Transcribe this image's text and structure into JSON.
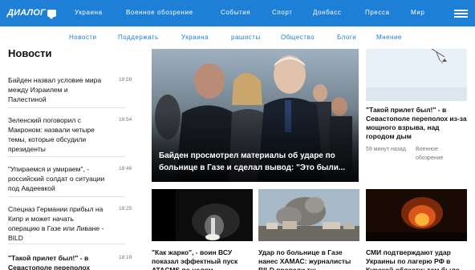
{
  "header": {
    "logo": "ДИАЛОГ",
    "nav": [
      "Украина",
      "Военное обозрение",
      "События",
      "Спорт",
      "Донбасс",
      "Пресса",
      "Мир"
    ]
  },
  "subnav": [
    "Новости",
    "Поддержать",
    "Украина",
    "рашисты",
    "Общество",
    "Блоги",
    "Мнение"
  ],
  "news": {
    "title": "Новости",
    "items": [
      {
        "text": "Байден назвал условие мира между Израилем и Палестиной",
        "time": "18:59"
      },
      {
        "text": "Зеленский поговорил с Макроном: назвали четыре темы, которые обсудили президенты",
        "time": "18:54"
      },
      {
        "text": "\"Упираемся и умираем\", - российский солдат о ситуации под Авдеевкой",
        "time": "18:46"
      },
      {
        "text": "Спецназ Германии прибыл на Кипр и может начать операцию в Газе или Ливане - BILD",
        "time": "18:25"
      },
      {
        "text": "\"Такой прилет был!\" - в Севастополе переполох",
        "time": "18:19"
      }
    ]
  },
  "feature": {
    "title": "Байден просмотрел материалы об ударе по больнице в Газе и сделал вывод: \"Это были..."
  },
  "side_card": {
    "title": "\"Такой прилет был!\" - в Севастополе переполох из-за мощного взрыва, над городом дым",
    "time": "59 минут назад",
    "category": "Военное обозрение"
  },
  "bottom_cards": [
    {
      "title": "\"Как жарко\", - воин ВСУ показал эффектный пуск ATACMS по целям"
    },
    {
      "title": "Удар по больнице в Газе нанес ХАМАС: журналисты BILD провели тщ"
    },
    {
      "title": "СМИ подтверждают удар Украины по лагерю РФ в Курской области: там было"
    }
  ],
  "colors": {
    "brand": "#1d7fd6",
    "text": "#111111",
    "muted": "#777777"
  }
}
